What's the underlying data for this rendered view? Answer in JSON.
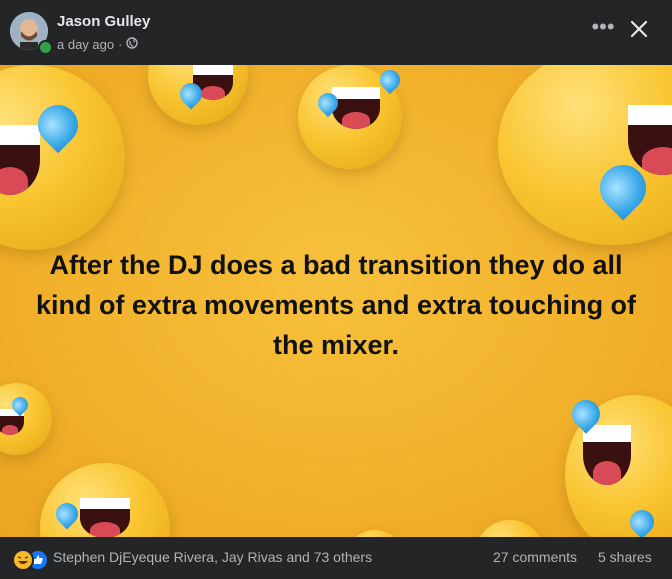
{
  "post": {
    "author": "Jason Gulley",
    "time": "a day ago",
    "separator": "·",
    "privacy_icon": "globe-icon",
    "more_icon": "ellipsis-icon",
    "close_icon": "close-icon",
    "text": "After the DJ does a bad transition they do all kind of extra movements and extra touching of the mixer."
  },
  "footer": {
    "reaction_icons": [
      "haha-icon",
      "like-icon"
    ],
    "reactors": "Stephen DjEyeque Rivera, Jay Rivas and 73 others",
    "comments": "27 comments",
    "shares": "5 shares"
  },
  "colors": {
    "background": "#f2b22c",
    "header": "#242526",
    "text_secondary": "#b0b3b8",
    "online": "#31a24c",
    "like_blue": "#1877f2"
  }
}
